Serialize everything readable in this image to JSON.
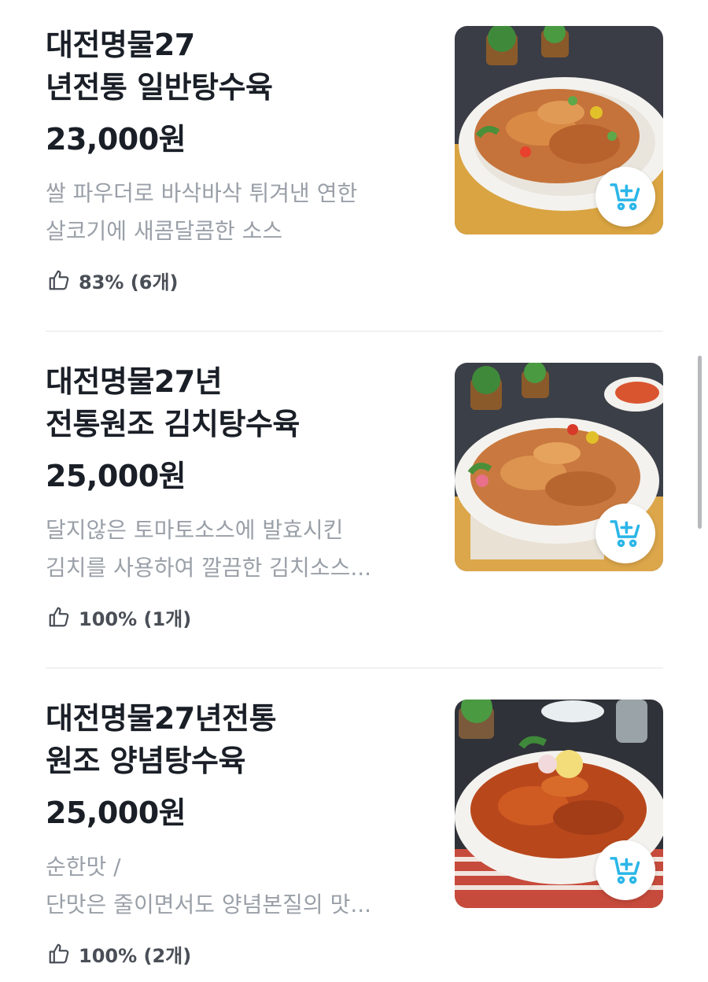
{
  "menu_items": [
    {
      "title": "대전명물27\n년전통 일반탕수육",
      "price": "23,000원",
      "description": "쌀 파우더로 바삭바삭 튀겨낸 연한\n살코기에 새콤달콤한 소스",
      "rating": "83% (6개)"
    },
    {
      "title": "대전명물27년\n전통원조    김치탕수육",
      "price": "25,000원",
      "description": "달지않은 토마토소스에 발효시킨\n김치를 사용하여 깔끔한 김치소스...",
      "rating": "100% (1개)"
    },
    {
      "title": "대전명물27년전통\n원조       양념탕수육",
      "price": "25,000원",
      "description": "순한맛 /\n단맛은 줄이면서도 양념본질의 맛...",
      "rating": "100% (2개)"
    }
  ],
  "icons": {
    "rating": "thumbs-up-icon",
    "cart": "add-to-cart-icon"
  },
  "colors": {
    "title": "#1a1f27",
    "description": "#9aa0a8",
    "rating_text": "#4a4f57",
    "cart_icon": "#2bb6e8"
  }
}
